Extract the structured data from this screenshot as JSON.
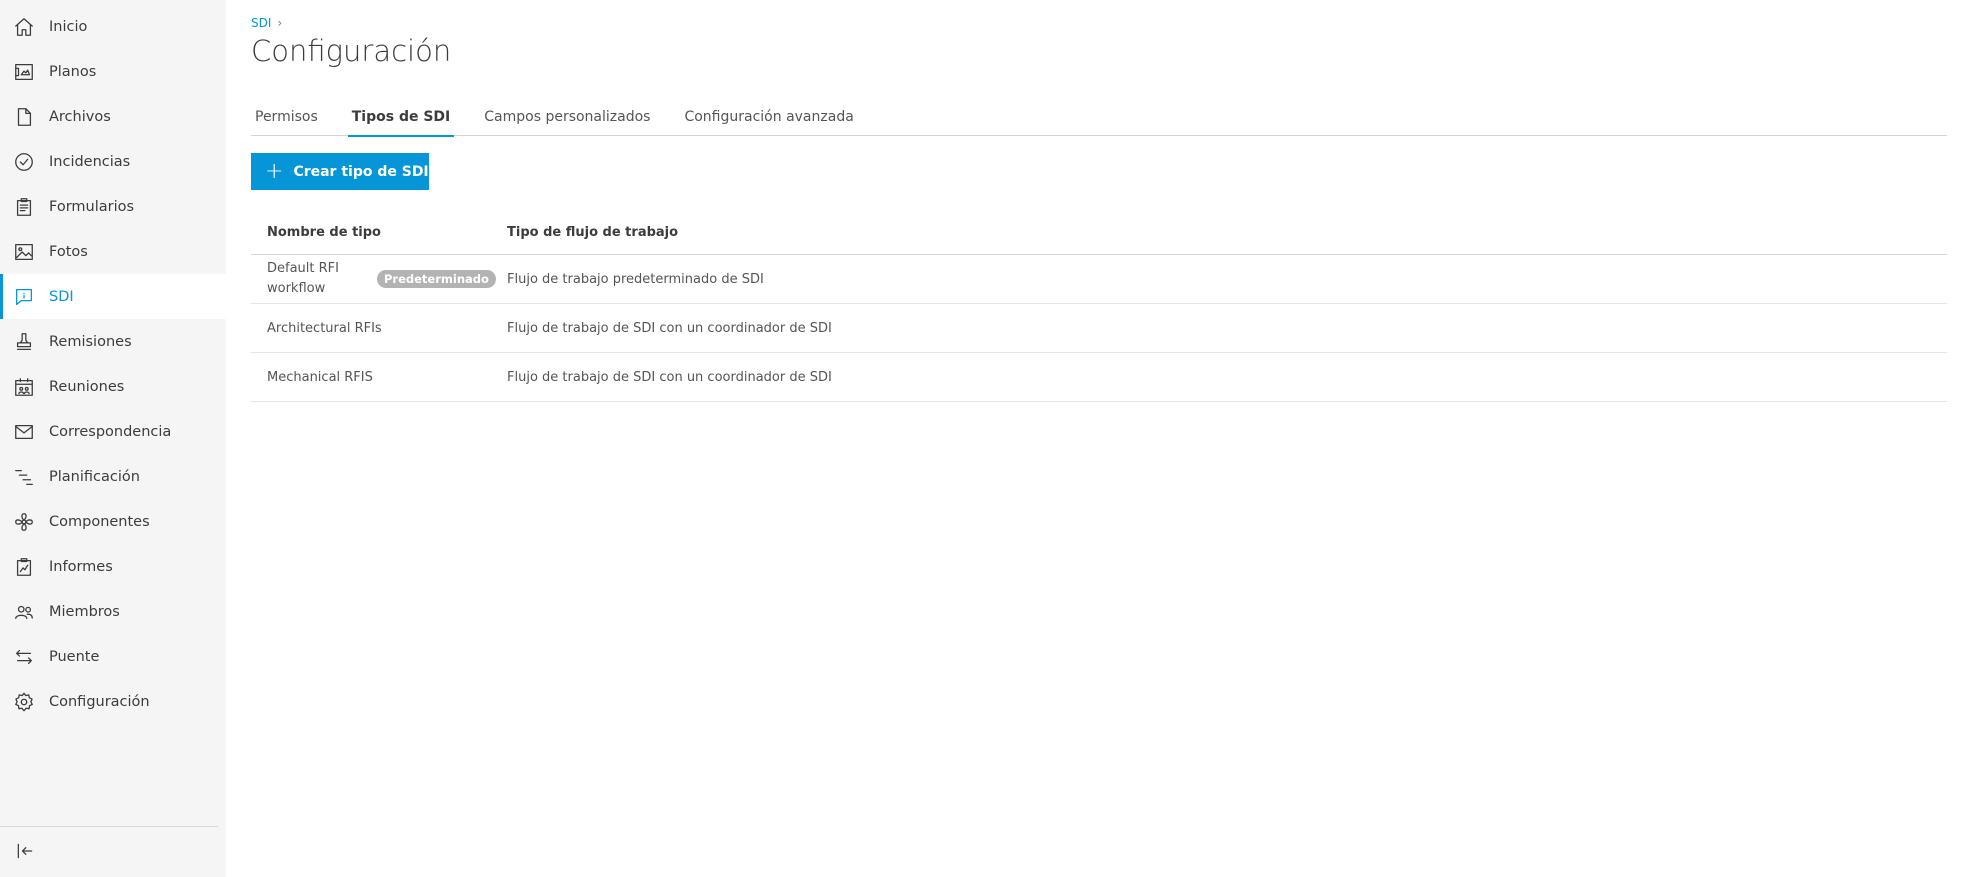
{
  "sidebar": {
    "items": [
      {
        "label": "Inicio",
        "icon": "home-icon"
      },
      {
        "label": "Planos",
        "icon": "sheets-icon"
      },
      {
        "label": "Archivos",
        "icon": "file-icon"
      },
      {
        "label": "Incidencias",
        "icon": "check-circle-icon"
      },
      {
        "label": "Formularios",
        "icon": "clipboard-icon"
      },
      {
        "label": "Fotos",
        "icon": "photo-icon"
      },
      {
        "label": "SDI",
        "icon": "rfi-chat-icon",
        "active": true
      },
      {
        "label": "Remisiones",
        "icon": "stamp-icon"
      },
      {
        "label": "Reuniones",
        "icon": "calendar-people-icon"
      },
      {
        "label": "Correspondencia",
        "icon": "mail-icon"
      },
      {
        "label": "Planificación",
        "icon": "schedule-icon"
      },
      {
        "label": "Componentes",
        "icon": "fan-icon"
      },
      {
        "label": "Informes",
        "icon": "report-icon"
      },
      {
        "label": "Miembros",
        "icon": "members-icon"
      },
      {
        "label": "Puente",
        "icon": "bridge-arrows-icon"
      },
      {
        "label": "Configuración",
        "icon": "gear-icon"
      }
    ],
    "collapse_icon": "collapse-left-icon"
  },
  "breadcrumb": {
    "root": "SDI",
    "separator": "›"
  },
  "page": {
    "title": "Configuración"
  },
  "tabs": [
    {
      "label": "Permisos"
    },
    {
      "label": "Tipos de SDI",
      "active": true
    },
    {
      "label": "Campos personalizados"
    },
    {
      "label": "Configuración avanzada"
    }
  ],
  "actions": {
    "create_label": "Crear tipo de SDI",
    "create_icon": "plus-icon"
  },
  "table": {
    "headers": {
      "name": "Nombre de tipo",
      "workflow": "Tipo de flujo de trabajo"
    },
    "rows": [
      {
        "name": "Default RFI workflow",
        "badge": "Predeterminado",
        "workflow": "Flujo de trabajo predeterminado de SDI"
      },
      {
        "name": "Architectural RFIs",
        "workflow": "Flujo de trabajo de SDI con un coordinador de SDI"
      },
      {
        "name": "Mechanical RFIS",
        "workflow": "Flujo de trabajo de SDI con un coordinador de SDI"
      }
    ]
  },
  "colors": {
    "accent": "#0696d7",
    "sidebar_bg": "#f5f5f5",
    "badge_bg": "#b3b3b3"
  }
}
